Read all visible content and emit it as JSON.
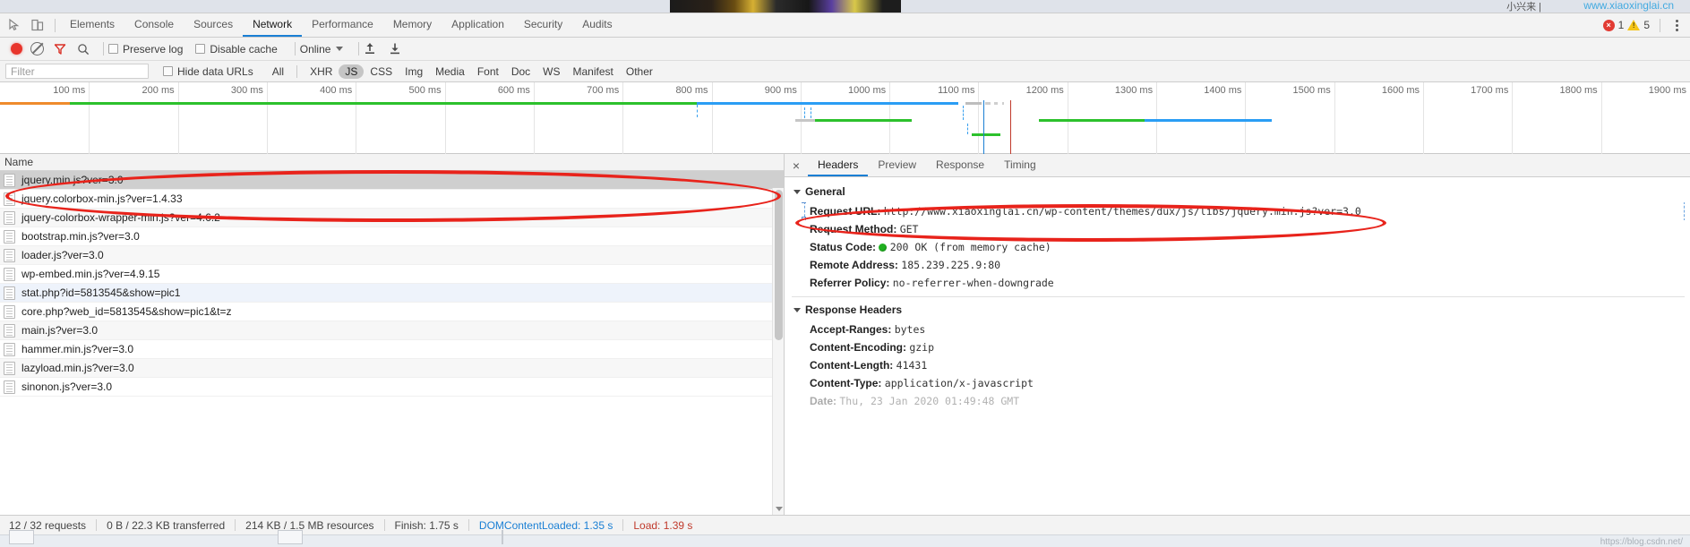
{
  "page_strip": {
    "site_link": "www.xiaoxinglai.cn",
    "crumb": "小兴来 |"
  },
  "devtools": {
    "main_tabs": [
      {
        "label": "Elements",
        "active": false
      },
      {
        "label": "Console",
        "active": false
      },
      {
        "label": "Sources",
        "active": false
      },
      {
        "label": "Network",
        "active": true
      },
      {
        "label": "Performance",
        "active": false
      },
      {
        "label": "Memory",
        "active": false
      },
      {
        "label": "Application",
        "active": false
      },
      {
        "label": "Security",
        "active": false
      },
      {
        "label": "Audits",
        "active": false
      }
    ],
    "error_count": "1",
    "warning_count": "5",
    "icons": {
      "inspect": "inspect-element-icon",
      "device": "device-toolbar-icon",
      "record": "record-icon",
      "clear": "clear-icon",
      "filter": "filter-funnel-icon",
      "search": "search-icon",
      "import": "import-har-icon",
      "export": "export-har-icon",
      "more": "more-options-icon"
    },
    "toolbar": {
      "preserve_log": "Preserve log",
      "disable_cache": "Disable cache",
      "throttle_value": "Online"
    },
    "filterbar": {
      "filter_placeholder": "Filter",
      "filter_value": "",
      "hide_data_urls": "Hide data URLs",
      "types": [
        {
          "label": "All",
          "selected": false
        },
        {
          "label": "XHR",
          "selected": false
        },
        {
          "label": "JS",
          "selected": true
        },
        {
          "label": "CSS",
          "selected": false
        },
        {
          "label": "Img",
          "selected": false
        },
        {
          "label": "Media",
          "selected": false
        },
        {
          "label": "Font",
          "selected": false
        },
        {
          "label": "Doc",
          "selected": false
        },
        {
          "label": "WS",
          "selected": false
        },
        {
          "label": "Manifest",
          "selected": false
        },
        {
          "label": "Other",
          "selected": false
        }
      ]
    },
    "overview": {
      "ticks": [
        "100 ms",
        "200 ms",
        "300 ms",
        "400 ms",
        "500 ms",
        "600 ms",
        "700 ms",
        "800 ms",
        "900 ms",
        "1000 ms",
        "1100 ms",
        "1200 ms",
        "1300 ms",
        "1400 ms",
        "1500 ms",
        "1600 ms",
        "1700 ms",
        "1800 ms",
        "1900 ms"
      ],
      "colors": {
        "orange": "#ef8b2c",
        "green": "#2cc12c",
        "blue": "#2a9df4",
        "grey": "#bdbdbd",
        "dcl_line": "#1a7fd4",
        "load_line": "#c0392b"
      }
    },
    "requests": {
      "column_header": "Name",
      "rows": [
        {
          "name": "jquery.min.js?ver=3.0",
          "state": "selected"
        },
        {
          "name": "jquery.colorbox-min.js?ver=1.4.33",
          "state": "normal"
        },
        {
          "name": "jquery-colorbox-wrapper-min.js?ver=4.6.2",
          "state": "alt"
        },
        {
          "name": "bootstrap.min.js?ver=3.0",
          "state": "normal"
        },
        {
          "name": "loader.js?ver=3.0",
          "state": "alt"
        },
        {
          "name": "wp-embed.min.js?ver=4.9.15",
          "state": "normal"
        },
        {
          "name": "stat.php?id=5813545&show=pic1",
          "state": "highlight"
        },
        {
          "name": "core.php?web_id=5813545&show=pic1&t=z",
          "state": "normal"
        },
        {
          "name": "main.js?ver=3.0",
          "state": "alt"
        },
        {
          "name": "hammer.min.js?ver=3.0",
          "state": "normal"
        },
        {
          "name": "lazyload.min.js?ver=3.0",
          "state": "alt"
        },
        {
          "name": "sinonon.js?ver=3.0",
          "state": "normal"
        }
      ]
    },
    "detail": {
      "tabs": [
        {
          "label": "Headers",
          "active": true
        },
        {
          "label": "Preview",
          "active": false
        },
        {
          "label": "Response",
          "active": false
        },
        {
          "label": "Timing",
          "active": false
        }
      ],
      "close_label": "×",
      "general": {
        "title": "General",
        "items": [
          {
            "key": "Request URL:",
            "value": "http://www.xiaoxinglai.cn/wp-content/themes/dux/js/libs/jquery.min.js?ver=3.0"
          },
          {
            "key": "Request Method:",
            "value": "GET"
          },
          {
            "key": "Status Code:",
            "value": "200 OK (from memory cache)",
            "status_dot": true
          },
          {
            "key": "Remote Address:",
            "value": "185.239.225.9:80"
          },
          {
            "key": "Referrer Policy:",
            "value": "no-referrer-when-downgrade"
          }
        ]
      },
      "response_headers": {
        "title": "Response Headers",
        "items": [
          {
            "key": "Accept-Ranges:",
            "value": "bytes"
          },
          {
            "key": "Content-Encoding:",
            "value": "gzip"
          },
          {
            "key": "Content-Length:",
            "value": "41431"
          },
          {
            "key": "Content-Type:",
            "value": "application/x-javascript"
          },
          {
            "key": "Date:",
            "value": "Thu, 23 Jan 2020 01:49:48 GMT"
          }
        ]
      }
    },
    "statusbar": {
      "requests": "12 / 32 requests",
      "transferred": "0 B / 22.3 KB transferred",
      "resources": "214 KB / 1.5 MB resources",
      "finish": "Finish: 1.75 s",
      "dom_content_loaded": "DOMContentLoaded: 1.35 s",
      "load": "Load: 1.39 s"
    }
  },
  "watermark": "https://blog.csdn.net/",
  "annotations": {
    "ellipse_requests": "red-ellipse-highlight-request-row",
    "ellipse_url": "red-ellipse-highlight-request-url"
  }
}
